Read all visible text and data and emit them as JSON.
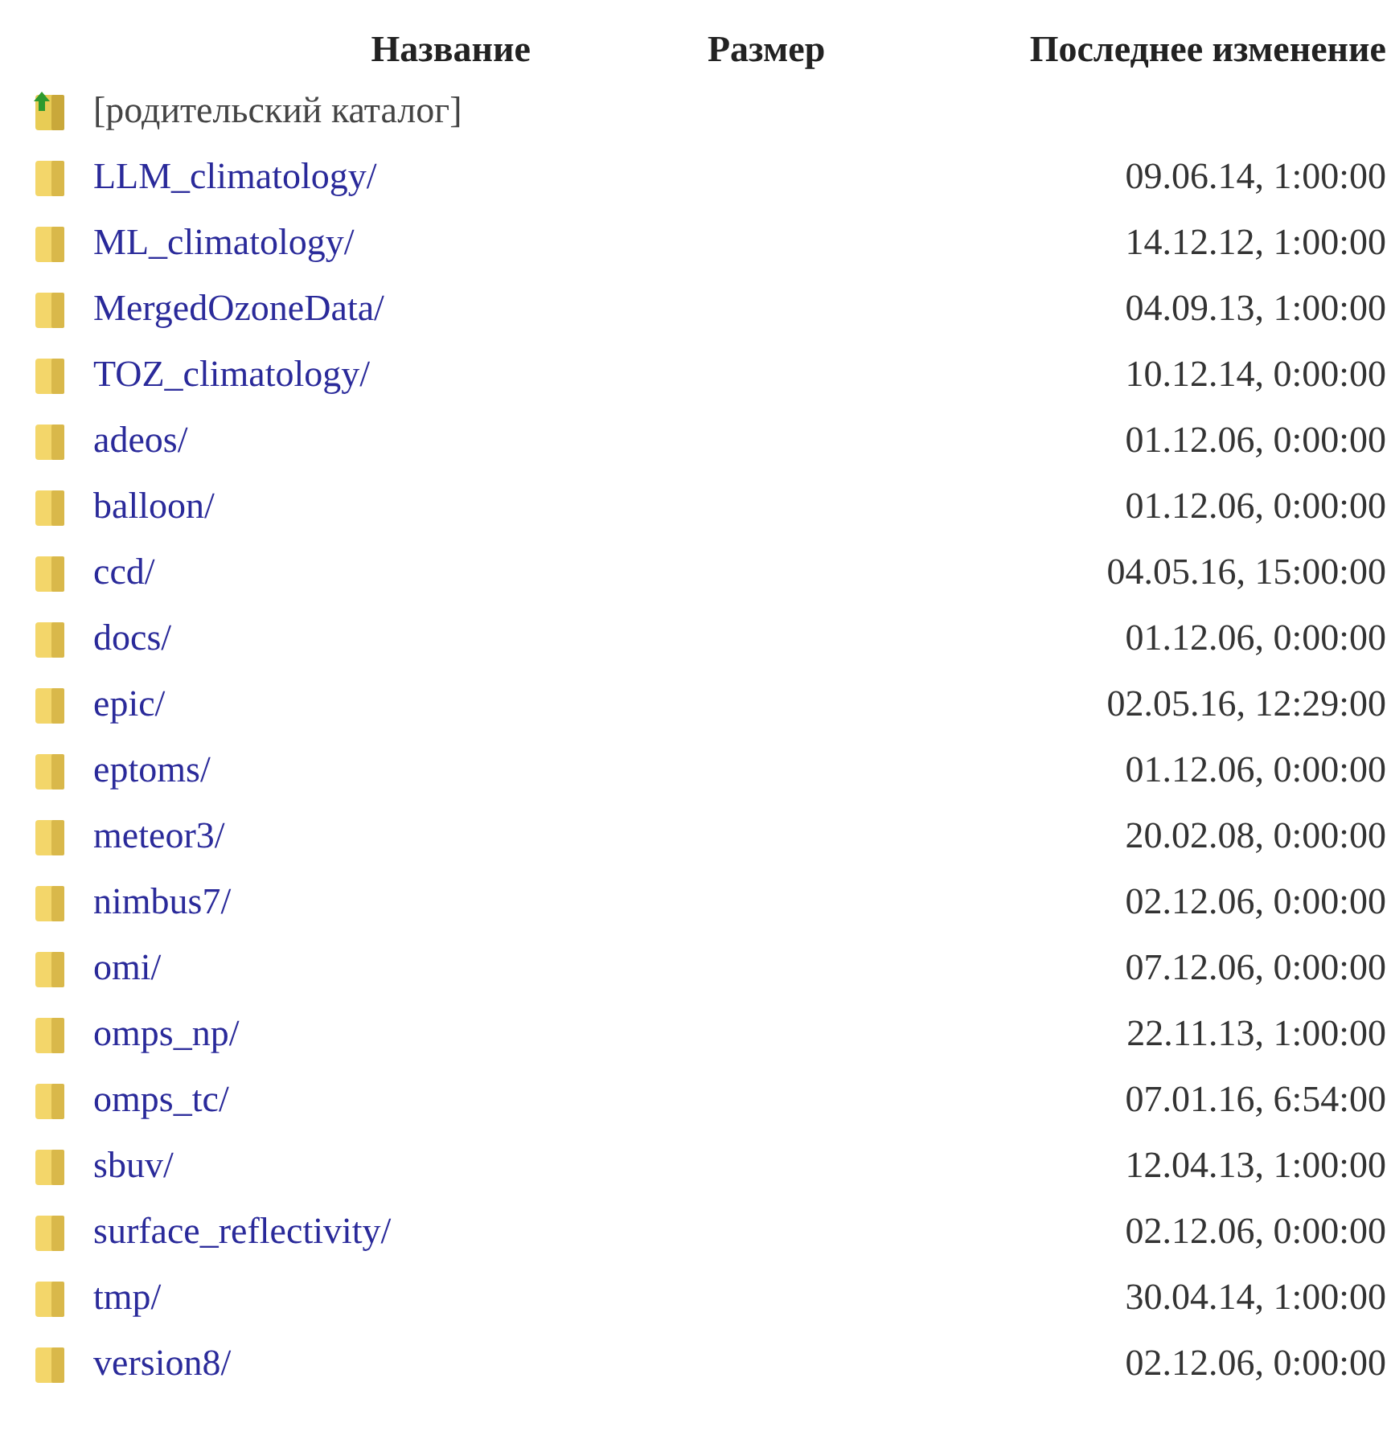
{
  "table": {
    "columns": [
      "Название",
      "Размер",
      "Последнее изменение"
    ],
    "rows": [
      {
        "kind": "parent",
        "name": "[родительский каталог]"
      },
      {
        "kind": "folder",
        "name": "LLM_climatology/",
        "modified": "09.06.14, 1:00:00"
      },
      {
        "kind": "folder",
        "name": "ML_climatology/",
        "modified": "14.12.12, 1:00:00"
      },
      {
        "kind": "folder",
        "name": "MergedOzoneData/",
        "modified": "04.09.13, 1:00:00"
      },
      {
        "kind": "folder",
        "name": "TOZ_climatology/",
        "modified": "10.12.14, 0:00:00"
      },
      {
        "kind": "folder",
        "name": "adeos/",
        "modified": "01.12.06, 0:00:00"
      },
      {
        "kind": "folder",
        "name": "balloon/",
        "modified": "01.12.06, 0:00:00"
      },
      {
        "kind": "folder",
        "name": "ccd/",
        "modified": "04.05.16, 15:00:00"
      },
      {
        "kind": "folder",
        "name": "docs/",
        "modified": "01.12.06, 0:00:00"
      },
      {
        "kind": "folder",
        "name": "epic/",
        "modified": "02.05.16, 12:29:00"
      },
      {
        "kind": "folder",
        "name": "eptoms/",
        "modified": "01.12.06, 0:00:00"
      },
      {
        "kind": "folder",
        "name": "meteor3/",
        "modified": "20.02.08, 0:00:00"
      },
      {
        "kind": "folder",
        "name": "nimbus7/",
        "modified": "02.12.06, 0:00:00"
      },
      {
        "kind": "folder",
        "name": "omi/",
        "modified": "07.12.06, 0:00:00"
      },
      {
        "kind": "folder",
        "name": "omps_np/",
        "modified": "22.11.13, 1:00:00"
      },
      {
        "kind": "folder",
        "name": "omps_tc/",
        "modified": "07.01.16, 6:54:00"
      },
      {
        "kind": "folder",
        "name": "sbuv/",
        "modified": "12.04.13, 1:00:00"
      },
      {
        "kind": "folder",
        "name": "surface_reflectivity/",
        "modified": "02.12.06, 0:00:00"
      },
      {
        "kind": "folder",
        "name": "tmp/",
        "modified": "30.04.14, 1:00:00"
      },
      {
        "kind": "folder",
        "name": "version8/",
        "modified": "02.12.06, 0:00:00"
      }
    ]
  }
}
